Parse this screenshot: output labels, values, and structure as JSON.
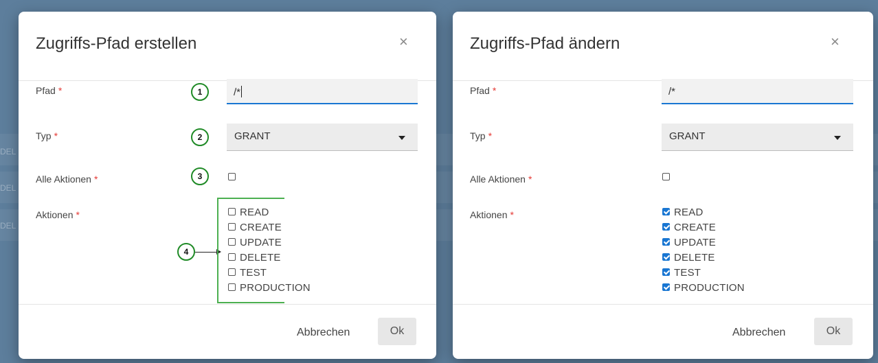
{
  "background": {
    "fragment_text": "DEL"
  },
  "dialog_create": {
    "title": "Zugriffs-Pfad erstellen",
    "close": "×",
    "path": {
      "label": "Pfad",
      "value": "/*"
    },
    "type": {
      "label": "Typ",
      "value": "GRANT"
    },
    "all_actions": {
      "label": "Alle Aktionen",
      "checked": false
    },
    "actions": {
      "label": "Aktionen",
      "items": [
        {
          "label": "READ",
          "checked": false
        },
        {
          "label": "CREATE",
          "checked": false
        },
        {
          "label": "UPDATE",
          "checked": false
        },
        {
          "label": "DELETE",
          "checked": false
        },
        {
          "label": "TEST",
          "checked": false
        },
        {
          "label": "PRODUCTION",
          "checked": false
        }
      ]
    },
    "cancel": "Abbrechen",
    "ok": "Ok"
  },
  "dialog_edit": {
    "title": "Zugriffs-Pfad ändern",
    "close": "×",
    "path": {
      "label": "Pfad",
      "value": "/*"
    },
    "type": {
      "label": "Typ",
      "value": "GRANT"
    },
    "all_actions": {
      "label": "Alle Aktionen",
      "checked": false
    },
    "actions": {
      "label": "Aktionen",
      "items": [
        {
          "label": "READ",
          "checked": true
        },
        {
          "label": "CREATE",
          "checked": true
        },
        {
          "label": "UPDATE",
          "checked": true
        },
        {
          "label": "DELETE",
          "checked": true
        },
        {
          "label": "TEST",
          "checked": true
        },
        {
          "label": "PRODUCTION",
          "checked": true
        }
      ]
    },
    "cancel": "Abbrechen",
    "ok": "Ok"
  },
  "annotations": [
    "1",
    "2",
    "3",
    "4"
  ],
  "colors": {
    "accent": "#1976d2",
    "required": "#e53935",
    "annotation": "#1f8a26",
    "backdrop": "#5d7e9c"
  }
}
